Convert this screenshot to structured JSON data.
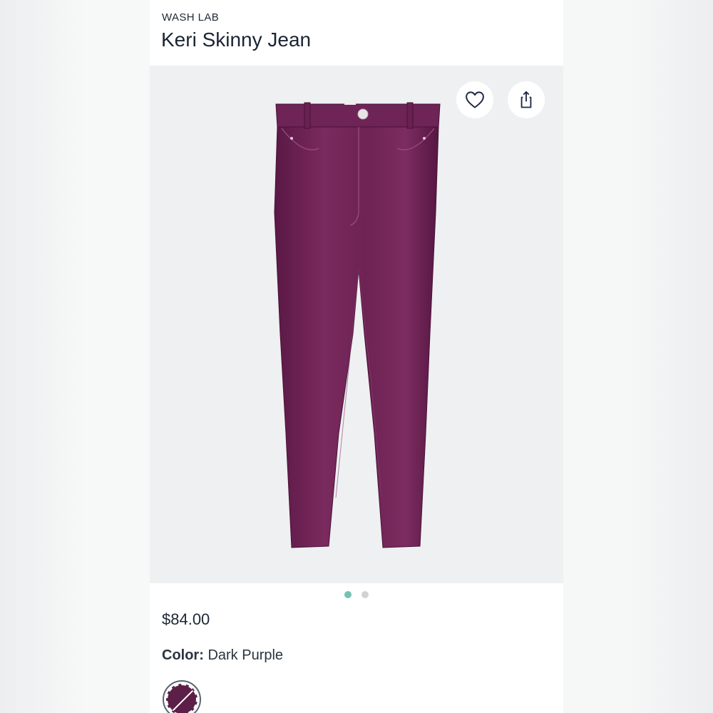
{
  "product": {
    "brand": "WASH LAB",
    "name": "Keri Skinny Jean",
    "price": "$84.00",
    "color_label": "Color:",
    "color_value": "Dark Purple"
  },
  "gallery": {
    "image_subject": "dark purple skinny jeans",
    "total_images": 2,
    "active_index": 0
  },
  "icons": {
    "favorite": "heart-icon",
    "share": "share-icon"
  },
  "colors": {
    "product_color": "#5c1f48",
    "active_dot": "#74c3b2",
    "inactive_dot": "#cfd3d6",
    "text_dark": "#1a2433"
  }
}
